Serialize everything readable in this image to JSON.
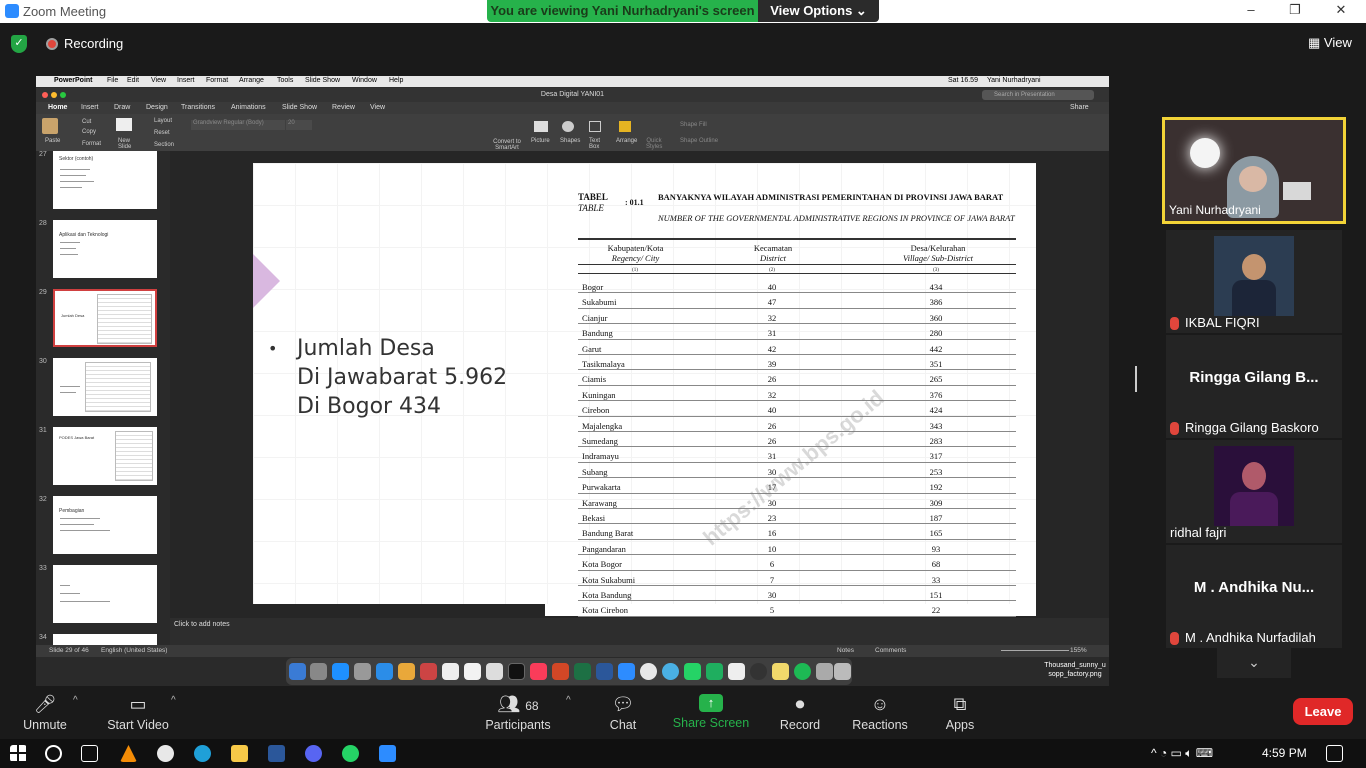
{
  "window": {
    "title": "Zoom Meeting",
    "min": "–",
    "max": "❐",
    "close": "✕"
  },
  "banner": {
    "viewing": "You are viewing Yani Nurhadryani's screen",
    "view_options": "View Options ⌄"
  },
  "top": {
    "recording": "Recording",
    "view": "View"
  },
  "mac_menu": {
    "apple": "",
    "items": [
      "PowerPoint",
      "File",
      "Edit",
      "View",
      "Insert",
      "Format",
      "Arrange",
      "Tools",
      "Slide Show",
      "Window",
      "Help"
    ],
    "right": [
      "Sat 16.59",
      "Yani Nurhadryani"
    ]
  },
  "ppt": {
    "doc_title": "Desa Digital YANI01",
    "search_placeholder": "Search in Presentation",
    "share": "Share",
    "tabs": [
      "Home",
      "Insert",
      "Draw",
      "Design",
      "Transitions",
      "Animations",
      "Slide Show",
      "Review",
      "View"
    ],
    "ribbon": {
      "paste": "Paste",
      "cut": "Cut",
      "copy": "Copy",
      "format": "Format",
      "new_slide": "New Slide",
      "layout": "Layout",
      "reset": "Reset",
      "section": "Section",
      "font": "Grandview Regular (Body)",
      "size": "20",
      "convert": "Convert to SmartArt",
      "picture": "Picture",
      "shapes": "Shapes",
      "textbox": "Text Box",
      "arrange": "Arrange",
      "quick_styles": "Quick Styles",
      "shape_fill": "Shape Fill",
      "shape_outline": "Shape Outline"
    },
    "thumbnails": [
      {
        "num": "27",
        "title": "Sektor (contoh)"
      },
      {
        "num": "28",
        "title": "Aplikasi dan Teknologi"
      },
      {
        "num": "29",
        "title": "Jumlah Desa"
      },
      {
        "num": "30",
        "title": ""
      },
      {
        "num": "31",
        "title": "PODES Jawa Barat"
      },
      {
        "num": "32",
        "title": "Pembagian"
      },
      {
        "num": "33",
        "title": ""
      },
      {
        "num": "34",
        "title": ""
      }
    ],
    "notes": "Click to add notes",
    "status": {
      "slide": "Slide 29 of 46",
      "lang": "English (United States)",
      "notes": "Notes",
      "comments": "Comments",
      "zoom": "155%"
    }
  },
  "slide": {
    "bullet": "•",
    "lines": [
      "Jumlah Desa",
      "Di Jawabarat 5.962",
      "Di Bogor 434"
    ],
    "table": {
      "label": "TABEL",
      "label_en": "TABLE",
      "number": ": 01.1",
      "heading": "BANYAKNYA WILAYAH ADMINISTRASI PEMERINTAHAN DI PROVINSI JAWA BARAT",
      "heading_en": "NUMBER OF THE GOVERNMENTAL ADMINISTRATIVE REGIONS IN PROVINCE OF JAWA BARAT",
      "col1": "Kabupaten/Kota",
      "col1_en": "Regency/ City",
      "col2": "Kecamatan",
      "col2_en": "District",
      "col3": "Desa/Kelurahan",
      "col3_en": "Village/ Sub-District",
      "idx": [
        "(1)",
        "(2)",
        "(3)"
      ],
      "rows": [
        [
          "Bogor",
          "40",
          "434"
        ],
        [
          "Sukabumi",
          "47",
          "386"
        ],
        [
          "Cianjur",
          "32",
          "360"
        ],
        [
          "Bandung",
          "31",
          "280"
        ],
        [
          "Garut",
          "42",
          "442"
        ],
        [
          "Tasikmalaya",
          "39",
          "351"
        ],
        [
          "Ciamis",
          "26",
          "265"
        ],
        [
          "Kuningan",
          "32",
          "376"
        ],
        [
          "Cirebon",
          "40",
          "424"
        ],
        [
          "Majalengka",
          "26",
          "343"
        ],
        [
          "Sumedang",
          "26",
          "283"
        ],
        [
          "Indramayu",
          "31",
          "317"
        ],
        [
          "Subang",
          "30",
          "253"
        ],
        [
          "Purwakarta",
          "17",
          "192"
        ],
        [
          "Karawang",
          "30",
          "309"
        ],
        [
          "Bekasi",
          "23",
          "187"
        ],
        [
          "Bandung Barat",
          "16",
          "165"
        ],
        [
          "Pangandaran",
          "10",
          "93"
        ],
        [
          "Kota Bogor",
          "6",
          "68"
        ],
        [
          "Kota Sukabumi",
          "7",
          "33"
        ],
        [
          "Kota Bandung",
          "30",
          "151"
        ],
        [
          "Kota Cirebon",
          "5",
          "22"
        ]
      ],
      "watermark": "https://www.bps.go.id"
    }
  },
  "dock_file": [
    "Thousand_sunny_u",
    "sopp_factory.png"
  ],
  "gallery": [
    {
      "name": "Yani Nurhadryani",
      "big": ""
    },
    {
      "name": "IKBAL FIQRI",
      "big": ""
    },
    {
      "name": "Ringga Gilang Baskoro",
      "big": "Ringga Gilang B..."
    },
    {
      "name": "ridhal fajri",
      "big": ""
    },
    {
      "name": "M . Andhika Nurfadilah",
      "big": "M . Andhika Nu..."
    }
  ],
  "toolbar": {
    "unmute": "Unmute",
    "start_video": "Start Video",
    "participants_count": "68",
    "participants": "Participants",
    "chat": "Chat",
    "share_screen": "Share Screen",
    "record": "Record",
    "reactions": "Reactions",
    "apps": "Apps",
    "leave": "Leave"
  },
  "taskbar": {
    "time": "4:59 PM"
  },
  "colors": {
    "share_green": "#26b24b",
    "leave_red": "#e02828",
    "active_border": "#f2d337"
  }
}
